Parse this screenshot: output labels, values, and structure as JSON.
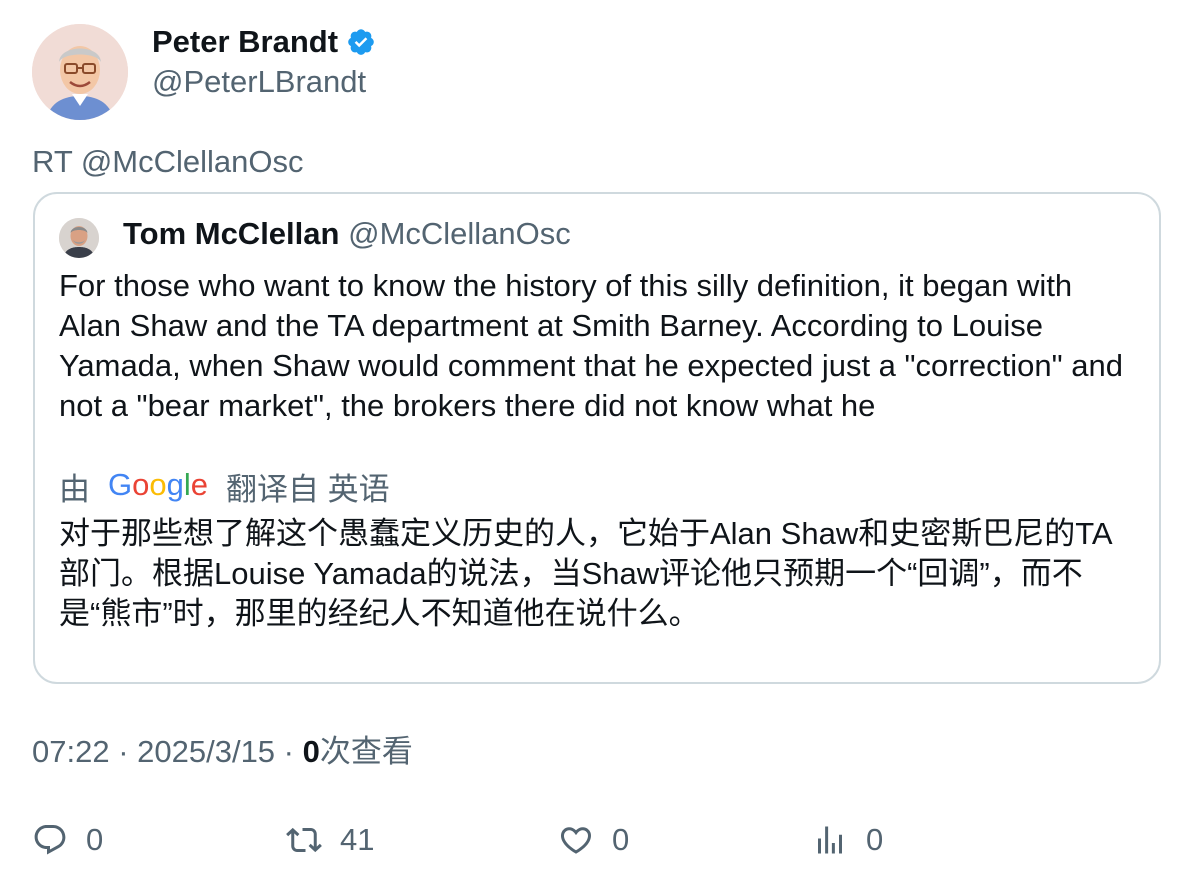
{
  "author": {
    "name": "Peter Brandt",
    "handle": "@PeterLBrandt",
    "verified_color": "#1d9bf0"
  },
  "retweet_label": "RT @McClellanOsc",
  "quoted": {
    "name": "Tom McClellan",
    "handle": "@McClellanOsc",
    "text": "For those who want to know the history of this silly definition, it began with Alan Shaw and the TA department at Smith Barney. According to Louise Yamada, when Shaw would comment that he expected just a \"correction\" and not a \"bear market\", the brokers there did not know what he",
    "translate": {
      "prefix": "由",
      "brand": "Google",
      "suffix": "翻译自 英语"
    },
    "translated_text": "对于那些想了解这个愚蠢定义历史的人，它始于Alan Shaw和史密斯巴尼的TA部门。根据Louise Yamada的说法，当Shaw评论他只预期一个“回调”，而不是“熊市”时，那里的经纪人不知道他在说什么。"
  },
  "meta": {
    "time": "07:22",
    "sep1": " · ",
    "date": "2025/3/15",
    "sep2": " · ",
    "views_count": "0",
    "views_label": "次查看"
  },
  "actions": {
    "reply": {
      "icon": "reply-icon",
      "count": "0"
    },
    "retweet": {
      "icon": "retweet-icon",
      "count": "41"
    },
    "like": {
      "icon": "heart-icon",
      "count": "0"
    },
    "views": {
      "icon": "analytics-icon",
      "count": "0"
    }
  },
  "colors": {
    "text": "#0f1419",
    "muted": "#536471",
    "border": "#cfd9de",
    "google_blue": "#4285f4",
    "google_red": "#ea4335",
    "google_yellow": "#fbbc05",
    "google_green": "#34a853"
  }
}
